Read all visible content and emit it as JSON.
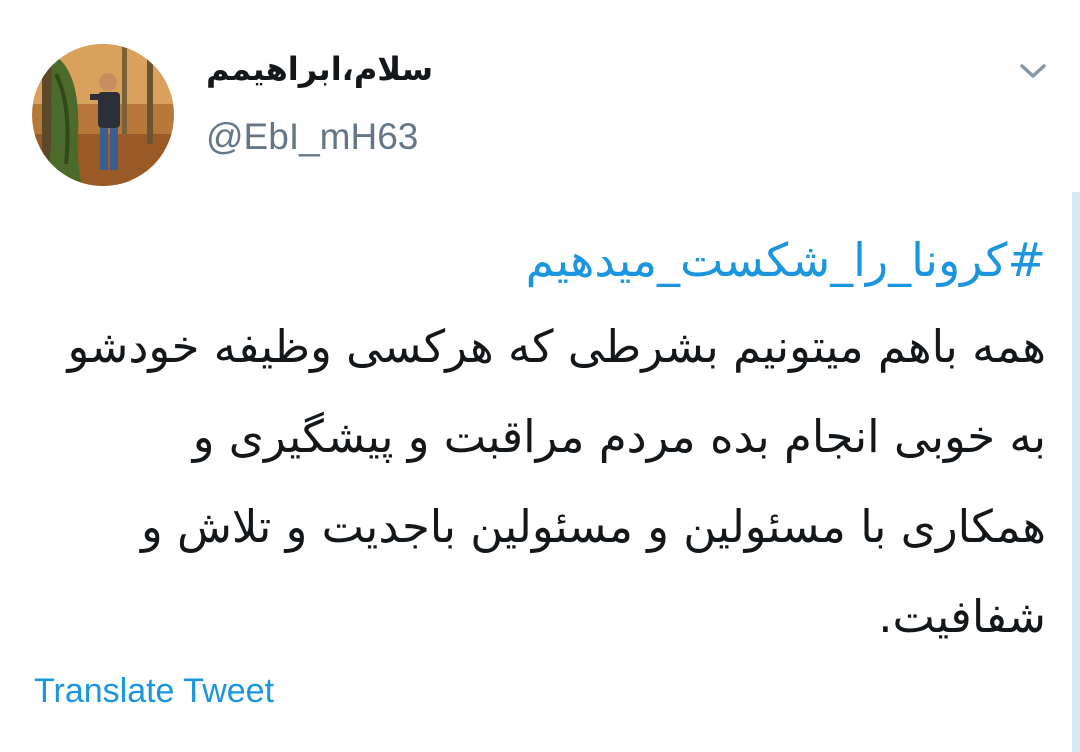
{
  "tweet": {
    "author": {
      "display_name": "سلام،ابراهیمم",
      "handle": "@EbI_mH63",
      "avatar": "profile-photo"
    },
    "hashtag": "#کرونا_را_شکست_میدهیم",
    "text": "همه باهم میتونیم بشرطی که هرکسی وظیفه خودشو به خوبی انجام بده مردم مراقبت و پیشگیری و همکاری با مسئولین و مسئولین باجدیت و تلاش و شفافیت.",
    "translate_label": "Translate Tweet",
    "menu_icon": "chevron-down-icon"
  },
  "colors": {
    "link": "#1b95e0",
    "text": "#14171a",
    "secondary": "#657786"
  }
}
